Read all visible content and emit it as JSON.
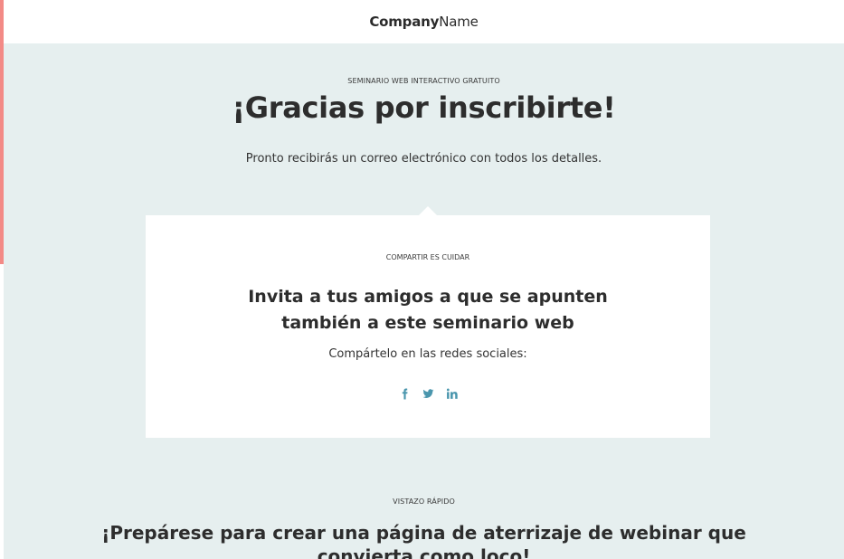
{
  "header": {
    "logo_bold": "Company",
    "logo_light": "Name"
  },
  "hero": {
    "eyebrow": "SEMINARIO WEB INTERACTIVO GRATUITO",
    "title": "¡Gracias por inscribirte!",
    "subtitle": "Pronto recibirás un correo electrónico con todos los detalles."
  },
  "share_card": {
    "eyebrow": "COMPARTIR ES CUIDAR",
    "title_line1": "Invita a tus amigos a que se apunten",
    "title_line2": "también a este seminario web",
    "subtitle": "Compártelo en las redes sociales:",
    "icons": [
      "facebook-icon",
      "twitter-icon",
      "linkedin-icon"
    ]
  },
  "overview": {
    "eyebrow": "VISTAZO RÁPIDO",
    "title_line1": "¡Prepárese para crear una página de aterrizaje de webinar que",
    "title_line2": "convierta como loco!"
  },
  "colors": {
    "accent_bar": "#f38a86",
    "hero_bg": "#e6efef",
    "icon": "#4a96ad",
    "text": "#2d2d2d"
  }
}
